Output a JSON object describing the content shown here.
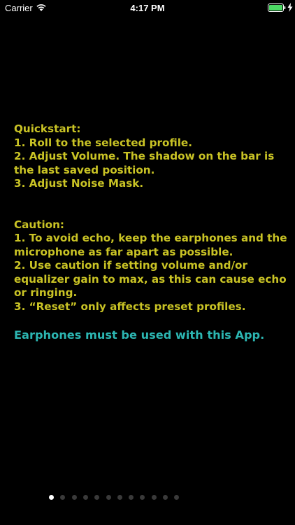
{
  "status_bar": {
    "carrier": "Carrier",
    "time": "4:17 PM",
    "wifi_icon": "wifi-icon",
    "battery_icon": "battery-full-icon",
    "charging_icon": "charging-bolt-icon",
    "battery_color": "#4cd964"
  },
  "quickstart": {
    "heading": "Quickstart:",
    "lines": [
      "1. Roll to the selected profile.",
      "2. Adjust Volume.  The shadow on the bar is the last saved position.",
      "3. Adjust Noise Mask."
    ]
  },
  "caution": {
    "heading": "Caution:",
    "lines": [
      "1. To avoid echo, keep the earphones and the microphone as far apart as possible.",
      "2. Use caution if setting volume and/or equalizer gain to max, as this can cause echo or ringing.",
      "3.  “Reset” only affects preset profiles."
    ]
  },
  "warning": {
    "text": "Earphones must be used with this App."
  },
  "pager": {
    "total_pages": 12,
    "current_page": 1
  },
  "colors": {
    "background": "#000000",
    "instruction_text": "#c9c325",
    "warning_text": "#2cb6b2",
    "dot_active": "#ffffff",
    "dot_inactive": "#3a3a3a"
  }
}
